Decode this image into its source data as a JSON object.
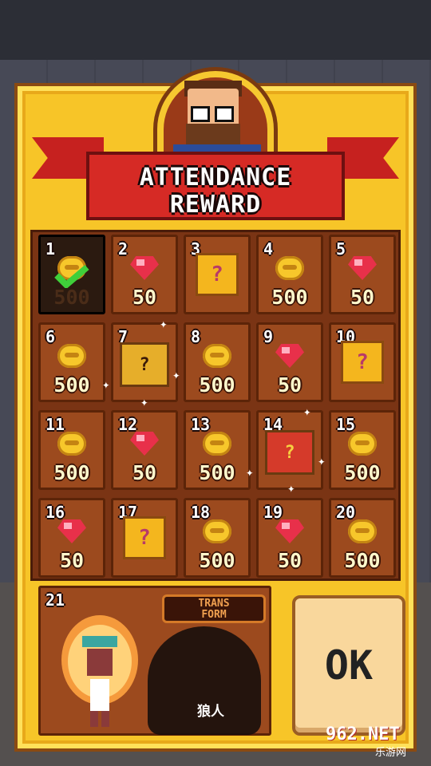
{
  "title": {
    "line1": "ATTENDANCE",
    "line2": "REWARD"
  },
  "colors": {
    "panel": "#f7c528",
    "ribbon": "#d62a25",
    "cell": "#9c4a1e",
    "gem": "#e8304a",
    "coin": "#f7c72b"
  },
  "days": [
    {
      "day": "1",
      "amount": "500",
      "reward": "coin",
      "claimed": true
    },
    {
      "day": "2",
      "amount": "50",
      "reward": "gem"
    },
    {
      "day": "3",
      "amount": "",
      "reward": "mystery-box"
    },
    {
      "day": "4",
      "amount": "500",
      "reward": "coin"
    },
    {
      "day": "5",
      "amount": "50",
      "reward": "gem"
    },
    {
      "day": "6",
      "amount": "500",
      "reward": "coin"
    },
    {
      "day": "7",
      "amount": "",
      "reward": "chest"
    },
    {
      "day": "8",
      "amount": "500",
      "reward": "coin"
    },
    {
      "day": "9",
      "amount": "50",
      "reward": "gem"
    },
    {
      "day": "10",
      "amount": "",
      "reward": "mystery-box"
    },
    {
      "day": "11",
      "amount": "500",
      "reward": "coin"
    },
    {
      "day": "12",
      "amount": "50",
      "reward": "gem"
    },
    {
      "day": "13",
      "amount": "500",
      "reward": "coin"
    },
    {
      "day": "14",
      "amount": "",
      "reward": "red-chest"
    },
    {
      "day": "15",
      "amount": "500",
      "reward": "coin"
    },
    {
      "day": "16",
      "amount": "50",
      "reward": "gem"
    },
    {
      "day": "17",
      "amount": "",
      "reward": "mystery-box"
    },
    {
      "day": "18",
      "amount": "500",
      "reward": "coin"
    },
    {
      "day": "19",
      "amount": "50",
      "reward": "gem"
    },
    {
      "day": "20",
      "amount": "500",
      "reward": "coin"
    }
  ],
  "special": {
    "day": "21",
    "badge_line1": "TRANS",
    "badge_line2": "FORM",
    "character_name": "狼人"
  },
  "ok_label": "OK",
  "watermark": {
    "main": "962.NET",
    "sub": "乐游网"
  }
}
